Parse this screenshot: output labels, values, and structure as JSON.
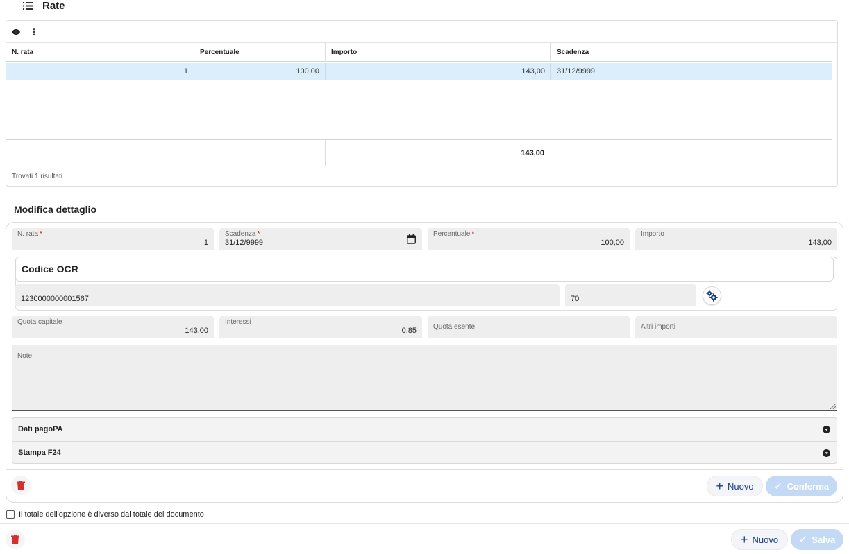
{
  "header": {
    "title": "Rate",
    "icon": "list-icon"
  },
  "grid": {
    "toolbar": {
      "view_icon": "eye-icon",
      "menu_icon": "more-vertical-icon"
    },
    "columns": [
      "N. rata",
      "Percentuale",
      "Importo",
      "Scadenza"
    ],
    "rows": [
      {
        "n_rata": "1",
        "percentuale": "100,00",
        "importo": "143,00",
        "scadenza": "31/12/9999"
      }
    ],
    "totals": {
      "importo": "143,00"
    },
    "count_text": "Trovati 1 risultati"
  },
  "detail": {
    "title": "Modifica dettaglio",
    "fields": {
      "n_rata": {
        "label": "N. rata",
        "value": "1",
        "required": "*"
      },
      "scadenza": {
        "label": "Scadenza",
        "value": "31/12/9999",
        "required": "*",
        "icon": "calendar-icon"
      },
      "percentuale": {
        "label": "Percentuale",
        "value": "100,00",
        "required": "*"
      },
      "importo": {
        "label": "Importo",
        "value": "143,00"
      },
      "quota_capitale": {
        "label": "Quota capitale",
        "value": "143,00"
      },
      "interessi": {
        "label": "Interessi",
        "value": "0,85"
      },
      "quota_esente": {
        "label": "Quota esente",
        "value": ""
      },
      "altri_importi": {
        "label": "Altri importi",
        "value": ""
      },
      "note": {
        "label": "Note",
        "value": ""
      }
    },
    "ocr": {
      "title": "Codice OCR",
      "code": "1230000000001567",
      "suffix": "70",
      "settings_icon": "gears-icon"
    },
    "accordion": [
      {
        "label": "Dati pagoPA",
        "icon": "chevron-down-circle-icon"
      },
      {
        "label": "Stampa F24",
        "icon": "chevron-down-circle-icon"
      }
    ],
    "actions": {
      "nuovo": "Nuovo",
      "conferma": "Conferma",
      "delete_icon": "trash-icon"
    }
  },
  "footer": {
    "checkbox_label": "Il totale dell'opzione è diverso dal totale del documento",
    "nuovo": "Nuovo",
    "salva": "Salva"
  },
  "colors": {
    "accent": "#1a3a8a",
    "selected_row": "#dcedfc",
    "danger": "#d32f2f",
    "disabled_button": "#c4d9f3"
  }
}
